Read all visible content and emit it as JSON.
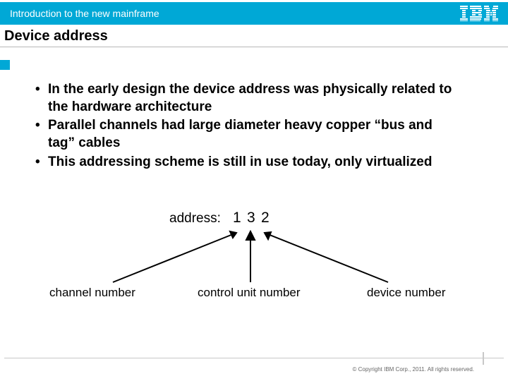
{
  "header": {
    "course_title": "Introduction to the new mainframe",
    "logo_name": "IBM"
  },
  "title": "Device address",
  "bullets": [
    "In the early design the device address was physically related to the hardware architecture",
    "Parallel channels had large diameter heavy copper “bus and tag” cables",
    "This addressing scheme is still in use today, only virtualized"
  ],
  "diagram": {
    "address_label": "address:",
    "digits": [
      "1",
      "3",
      "2"
    ],
    "captions": {
      "channel": "channel number",
      "control_unit": "control unit number",
      "device": "device number"
    }
  },
  "footer": {
    "copyright": "© Copyright IBM Corp., 2011. All rights reserved."
  }
}
